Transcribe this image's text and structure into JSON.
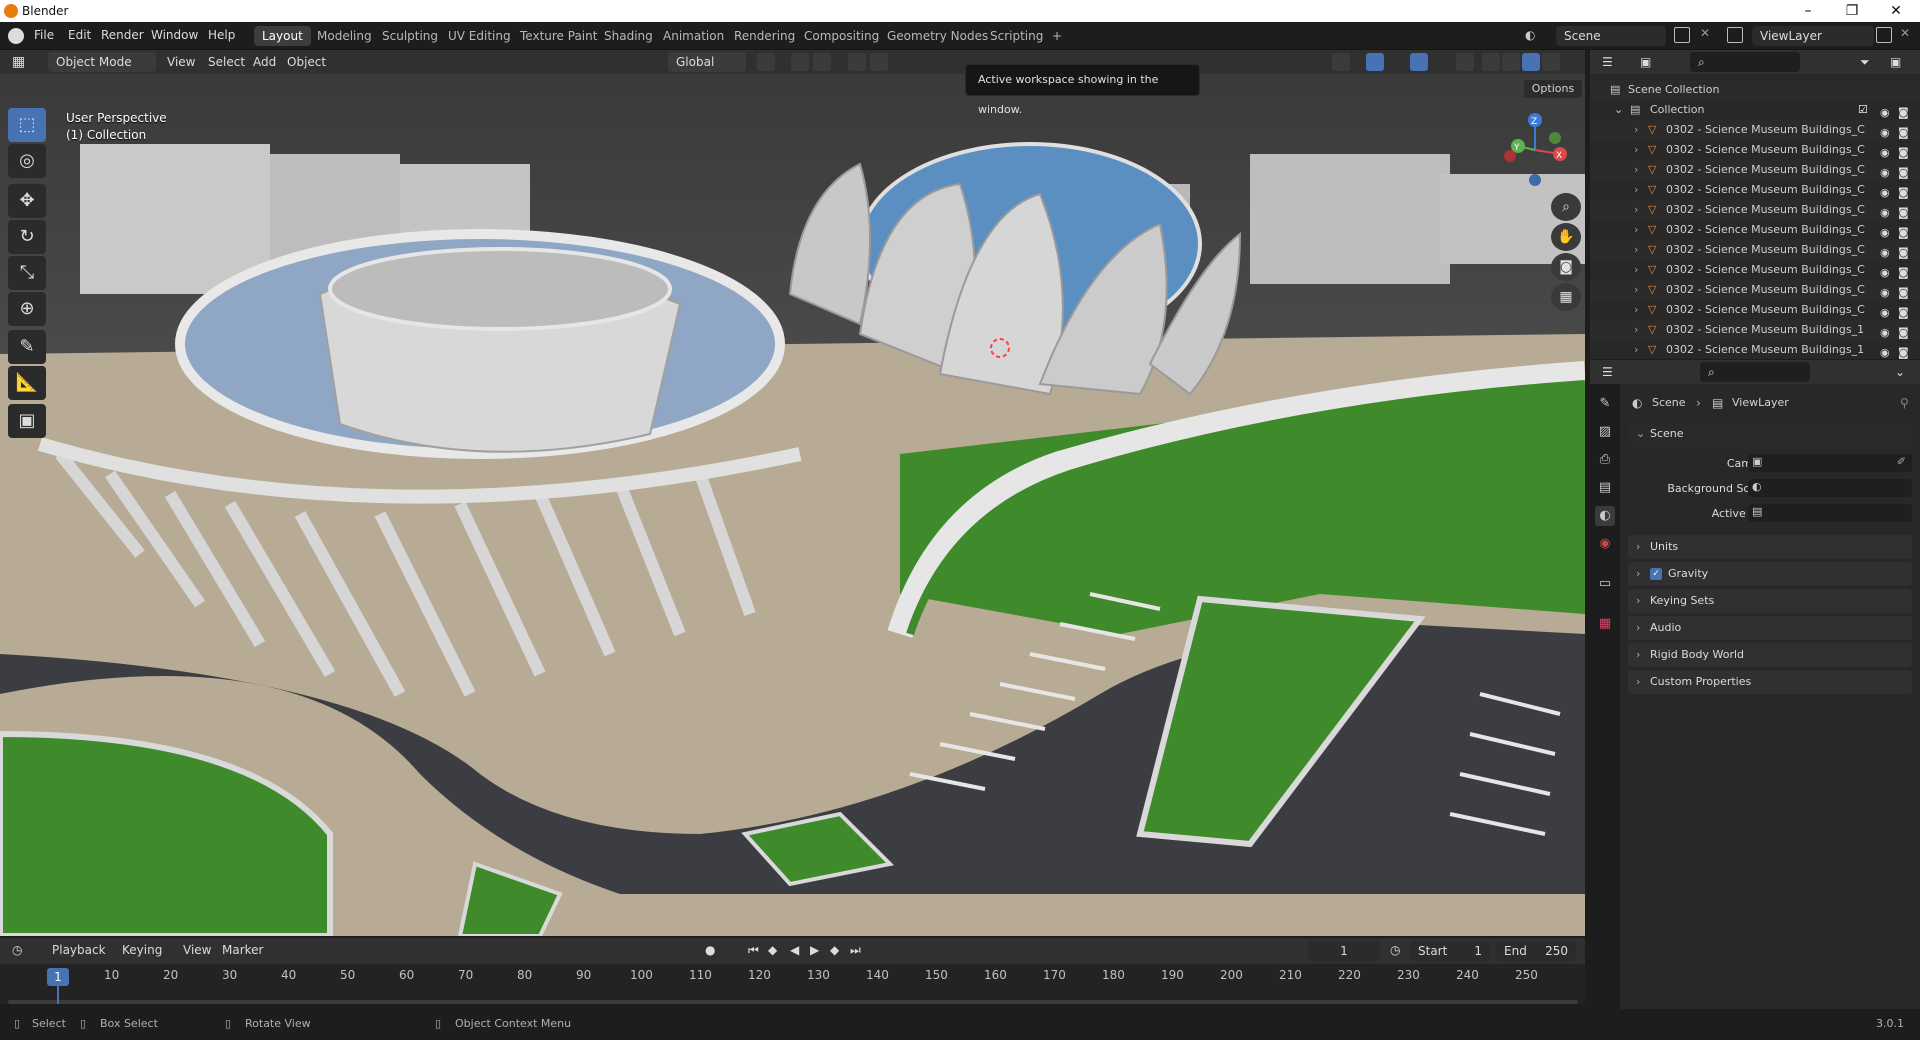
{
  "app": {
    "title": "Blender",
    "version": "3.0.1"
  },
  "window_controls": {
    "minimize": "–",
    "maximize": "❐",
    "close": "✕"
  },
  "topbar": {
    "menus": [
      "File",
      "Edit",
      "Render",
      "Window",
      "Help"
    ],
    "workspaces": [
      "Layout",
      "Modeling",
      "Sculpting",
      "UV Editing",
      "Texture Paint",
      "Shading",
      "Animation",
      "Rendering",
      "Compositing",
      "Geometry Nodes",
      "Scripting"
    ],
    "add_workspace": "+",
    "scene": "Scene",
    "view_layer": "ViewLayer"
  },
  "viewport_header": {
    "mode": "Object Mode",
    "menus": [
      "View",
      "Select",
      "Add",
      "Object"
    ],
    "transform_orientation": "Global",
    "options": "Options"
  },
  "tooltip": "Active workspace showing in the window.",
  "viewport": {
    "line1": "User Perspective",
    "line2": "(1) Collection"
  },
  "gizmo": {
    "z": "Z",
    "y": "Y",
    "x": "X"
  },
  "timeline": {
    "menus": [
      "Playback",
      "Keying",
      "View",
      "Marker"
    ],
    "current_frame": "1",
    "start_label": "Start",
    "start": "1",
    "end_label": "End",
    "end": "250",
    "ticks": [
      "10",
      "20",
      "30",
      "40",
      "50",
      "60",
      "70",
      "80",
      "90",
      "100",
      "110",
      "120",
      "130",
      "140",
      "150",
      "160",
      "170",
      "180",
      "190",
      "200",
      "210",
      "220",
      "230",
      "240",
      "250"
    ],
    "playhead": "1"
  },
  "statusbar": {
    "select": "Select",
    "box_select": "Box Select",
    "rotate": "Rotate View",
    "context": "Object Context Menu",
    "version": "3.0.1"
  },
  "outliner": {
    "root": "Scene Collection",
    "collection": "Collection",
    "items": [
      "0302 - Science Museum Buildings_C",
      "0302 - Science Museum Buildings_C",
      "0302 - Science Museum Buildings_C",
      "0302 - Science Museum Buildings_C",
      "0302 - Science Museum Buildings_C",
      "0302 - Science Museum Buildings_C",
      "0302 - Science Museum Buildings_C",
      "0302 - Science Museum Buildings_C",
      "0302 - Science Museum Buildings_C",
      "0302 - Science Museum Buildings_C",
      "0302 - Science Museum Buildings_1",
      "0302 - Science Museum Buildings_1"
    ]
  },
  "properties": {
    "breadcrumb": [
      "Scene",
      "ViewLayer"
    ],
    "panel": "Scene",
    "fields": [
      "Camera",
      "Background Scene",
      "Active Clip"
    ],
    "subpanels": [
      "Units",
      "Gravity",
      "Keying Sets",
      "Audio",
      "Rigid Body World",
      "Custom Properties"
    ]
  },
  "colors": {
    "accent": "#4772b3",
    "header": "#303030",
    "grass": "#3f8a2a",
    "asphalt": "#3b3d42"
  }
}
